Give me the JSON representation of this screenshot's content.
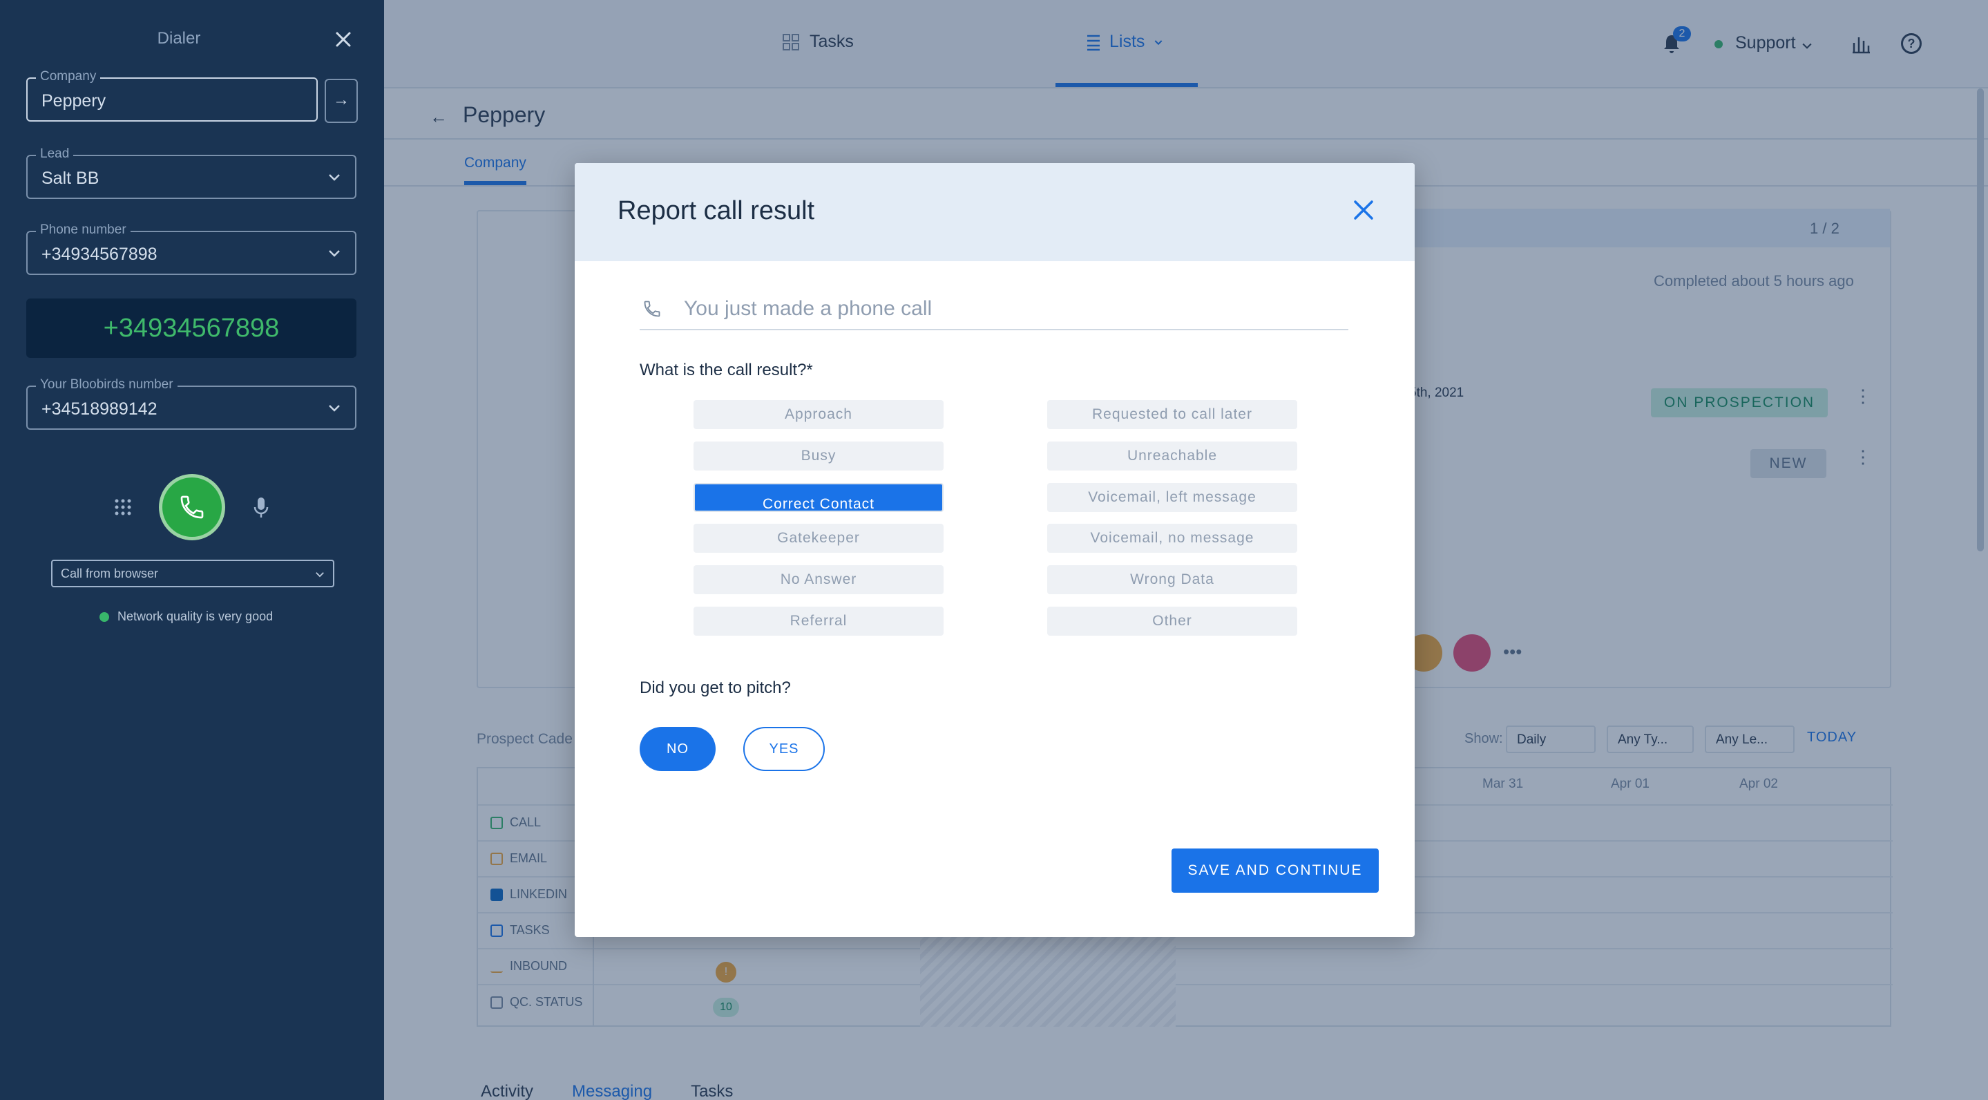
{
  "dialer": {
    "title": "Dialer",
    "company": {
      "label": "Company",
      "value": "Peppery"
    },
    "lead": {
      "label": "Lead",
      "value": "Salt BB"
    },
    "phone": {
      "label": "Phone number",
      "value": "+34934567898"
    },
    "big_number": "+34934567898",
    "bloobirds": {
      "label": "Your Bloobirds number",
      "value": "+34518989142"
    },
    "call_from": "Call from browser",
    "network": "Network quality is very good"
  },
  "topbar": {
    "tasks": "Tasks",
    "lists": "Lists",
    "notifications_count": "2",
    "support": "Support"
  },
  "page": {
    "title": "Peppery",
    "tab_company": "Company",
    "pager": "1 / 2",
    "completed": "Completed about 5 hours ago",
    "date_snippet": "5th, 2021",
    "status_prospection": "ON PROSPECTION",
    "status_new": "NEW"
  },
  "cadence": {
    "label": "Prospect Cade",
    "show": "Show:",
    "filter_period": "Daily",
    "filter_type": "Any Ty...",
    "filter_lead": "Any Le...",
    "today": "TODAY",
    "dates": [
      "Mar 31",
      "Apr 01",
      "Apr 02"
    ],
    "rows": [
      "CALL",
      "EMAIL",
      "LINKEDIN",
      "TASKS",
      "INBOUND",
      "QC. STATUS"
    ],
    "inbound_count": "!",
    "status_count": "10"
  },
  "bottom_tabs": [
    "Activity",
    "Messaging",
    "Tasks"
  ],
  "modal": {
    "title": "Report call result",
    "phone_prompt": "You just made a phone call",
    "question_result": "What is the call result?*",
    "results_left": [
      "Approach",
      "Busy",
      "Correct Contact",
      "Gatekeeper",
      "No Answer",
      "Referral"
    ],
    "results_right": [
      "Requested to call later",
      "Unreachable",
      "Voicemail, left message",
      "Voicemail, no message",
      "Wrong Data",
      "Other"
    ],
    "selected_result": "Correct Contact",
    "question_pitch": "Did you get to pitch?",
    "pitch_no": "NO",
    "pitch_yes": "YES",
    "pitch_selected": "NO",
    "save": "SAVE AND CONTINUE"
  },
  "colors": {
    "primary": "#1a73e8",
    "dialer_bg": "#1a3453",
    "call_green": "#28a745",
    "modal_header": "#e3ecf6"
  }
}
